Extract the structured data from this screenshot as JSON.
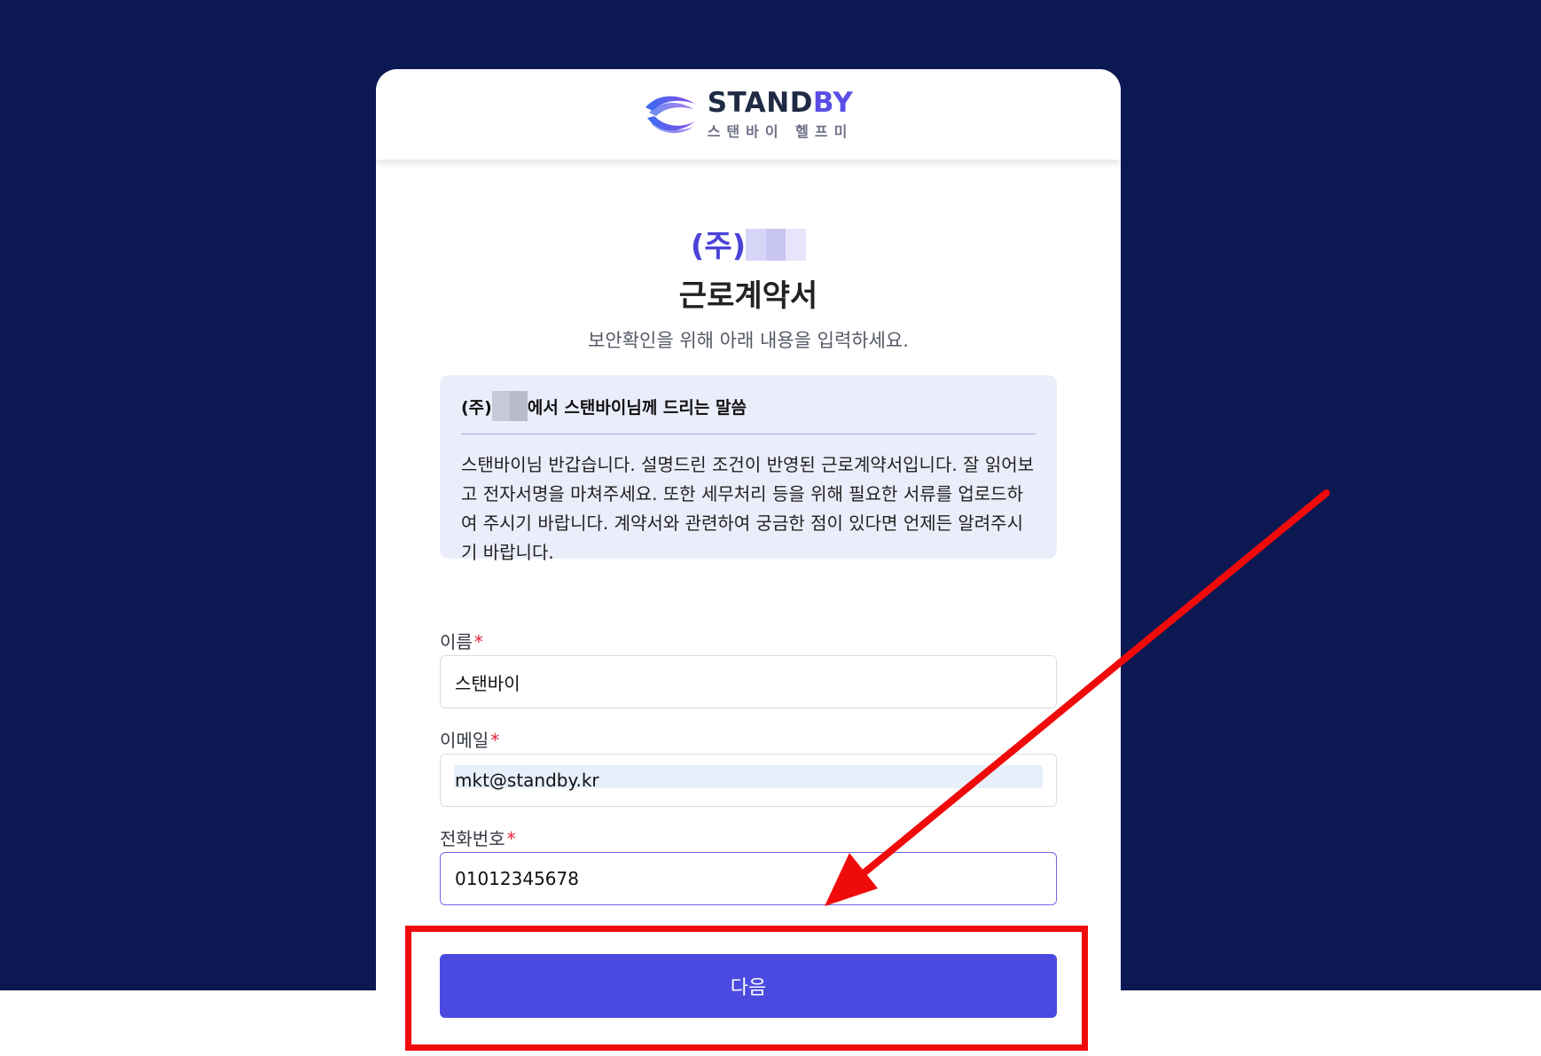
{
  "logo": {
    "word_a": "STAND",
    "word_b": "BY",
    "subtitle": "스탠바이 헬프미"
  },
  "header": {
    "company_prefix": "(주)",
    "document_title": "근로계약서",
    "instruction": "보안확인을 위해 아래 내용을 입력하세요."
  },
  "message": {
    "head_prefix": "(주)",
    "head_suffix": "에서 스탠바이님께 드리는 말씀",
    "body": "스탠바이님 반갑습니다. 설명드린 조건이 반영된 근로계약서입니다. 잘 읽어보고 전자서명을 마쳐주세요. 또한 세무처리 등을 위해 필요한 서류를 업로드하여 주시기 바랍니다. 계약서와 관련하여 궁금한 점이 있다면 언제든 알려주시기 바랍니다."
  },
  "form": {
    "name_label": "이름",
    "name_value": "스탠바이",
    "email_label": "이메일",
    "email_value": "mkt@standby.kr",
    "phone_label": "전화번호",
    "phone_value": "01012345678",
    "required_mark": "*"
  },
  "button": {
    "next_label": "다음"
  },
  "colors": {
    "background": "#0c1851",
    "accent": "#4b4ae0",
    "annotation": "#f00b0b"
  }
}
